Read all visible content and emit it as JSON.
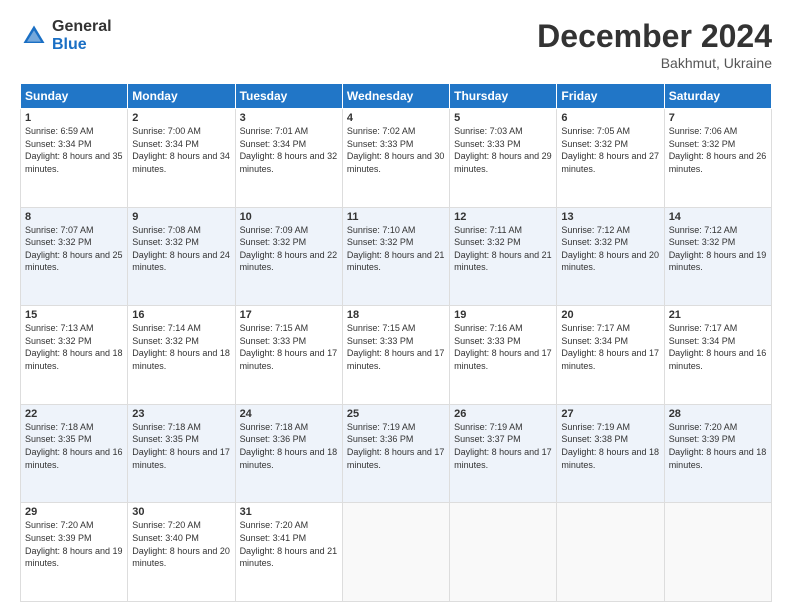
{
  "header": {
    "logo_general": "General",
    "logo_blue": "Blue",
    "month_title": "December 2024",
    "location": "Bakhmut, Ukraine"
  },
  "columns": [
    "Sunday",
    "Monday",
    "Tuesday",
    "Wednesday",
    "Thursday",
    "Friday",
    "Saturday"
  ],
  "weeks": [
    [
      {
        "day": "1",
        "sunrise": "6:59 AM",
        "sunset": "3:34 PM",
        "daylight": "8 hours and 35 minutes."
      },
      {
        "day": "2",
        "sunrise": "7:00 AM",
        "sunset": "3:34 PM",
        "daylight": "8 hours and 34 minutes."
      },
      {
        "day": "3",
        "sunrise": "7:01 AM",
        "sunset": "3:34 PM",
        "daylight": "8 hours and 32 minutes."
      },
      {
        "day": "4",
        "sunrise": "7:02 AM",
        "sunset": "3:33 PM",
        "daylight": "8 hours and 30 minutes."
      },
      {
        "day": "5",
        "sunrise": "7:03 AM",
        "sunset": "3:33 PM",
        "daylight": "8 hours and 29 minutes."
      },
      {
        "day": "6",
        "sunrise": "7:05 AM",
        "sunset": "3:32 PM",
        "daylight": "8 hours and 27 minutes."
      },
      {
        "day": "7",
        "sunrise": "7:06 AM",
        "sunset": "3:32 PM",
        "daylight": "8 hours and 26 minutes."
      }
    ],
    [
      {
        "day": "8",
        "sunrise": "7:07 AM",
        "sunset": "3:32 PM",
        "daylight": "8 hours and 25 minutes."
      },
      {
        "day": "9",
        "sunrise": "7:08 AM",
        "sunset": "3:32 PM",
        "daylight": "8 hours and 24 minutes."
      },
      {
        "day": "10",
        "sunrise": "7:09 AM",
        "sunset": "3:32 PM",
        "daylight": "8 hours and 22 minutes."
      },
      {
        "day": "11",
        "sunrise": "7:10 AM",
        "sunset": "3:32 PM",
        "daylight": "8 hours and 21 minutes."
      },
      {
        "day": "12",
        "sunrise": "7:11 AM",
        "sunset": "3:32 PM",
        "daylight": "8 hours and 21 minutes."
      },
      {
        "day": "13",
        "sunrise": "7:12 AM",
        "sunset": "3:32 PM",
        "daylight": "8 hours and 20 minutes."
      },
      {
        "day": "14",
        "sunrise": "7:12 AM",
        "sunset": "3:32 PM",
        "daylight": "8 hours and 19 minutes."
      }
    ],
    [
      {
        "day": "15",
        "sunrise": "7:13 AM",
        "sunset": "3:32 PM",
        "daylight": "8 hours and 18 minutes."
      },
      {
        "day": "16",
        "sunrise": "7:14 AM",
        "sunset": "3:32 PM",
        "daylight": "8 hours and 18 minutes."
      },
      {
        "day": "17",
        "sunrise": "7:15 AM",
        "sunset": "3:33 PM",
        "daylight": "8 hours and 17 minutes."
      },
      {
        "day": "18",
        "sunrise": "7:15 AM",
        "sunset": "3:33 PM",
        "daylight": "8 hours and 17 minutes."
      },
      {
        "day": "19",
        "sunrise": "7:16 AM",
        "sunset": "3:33 PM",
        "daylight": "8 hours and 17 minutes."
      },
      {
        "day": "20",
        "sunrise": "7:17 AM",
        "sunset": "3:34 PM",
        "daylight": "8 hours and 17 minutes."
      },
      {
        "day": "21",
        "sunrise": "7:17 AM",
        "sunset": "3:34 PM",
        "daylight": "8 hours and 16 minutes."
      }
    ],
    [
      {
        "day": "22",
        "sunrise": "7:18 AM",
        "sunset": "3:35 PM",
        "daylight": "8 hours and 16 minutes."
      },
      {
        "day": "23",
        "sunrise": "7:18 AM",
        "sunset": "3:35 PM",
        "daylight": "8 hours and 17 minutes."
      },
      {
        "day": "24",
        "sunrise": "7:18 AM",
        "sunset": "3:36 PM",
        "daylight": "8 hours and 18 minutes."
      },
      {
        "day": "25",
        "sunrise": "7:19 AM",
        "sunset": "3:36 PM",
        "daylight": "8 hours and 17 minutes."
      },
      {
        "day": "26",
        "sunrise": "7:19 AM",
        "sunset": "3:37 PM",
        "daylight": "8 hours and 17 minutes."
      },
      {
        "day": "27",
        "sunrise": "7:19 AM",
        "sunset": "3:38 PM",
        "daylight": "8 hours and 18 minutes."
      },
      {
        "day": "28",
        "sunrise": "7:20 AM",
        "sunset": "3:39 PM",
        "daylight": "8 hours and 18 minutes."
      }
    ],
    [
      {
        "day": "29",
        "sunrise": "7:20 AM",
        "sunset": "3:39 PM",
        "daylight": "8 hours and 19 minutes."
      },
      {
        "day": "30",
        "sunrise": "7:20 AM",
        "sunset": "3:40 PM",
        "daylight": "8 hours and 20 minutes."
      },
      {
        "day": "31",
        "sunrise": "7:20 AM",
        "sunset": "3:41 PM",
        "daylight": "8 hours and 21 minutes."
      },
      null,
      null,
      null,
      null
    ]
  ]
}
